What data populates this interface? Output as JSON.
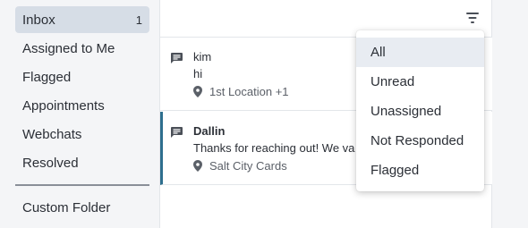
{
  "sidebar": {
    "items": [
      {
        "label": "Inbox",
        "count": "1",
        "active": true
      },
      {
        "label": "Assigned to Me"
      },
      {
        "label": "Flagged"
      },
      {
        "label": "Appointments"
      },
      {
        "label": "Webchats"
      },
      {
        "label": "Resolved"
      }
    ],
    "custom_folder": "Custom Folder"
  },
  "conversations": [
    {
      "name": "kim",
      "message": "hi",
      "location": "1st Location +1"
    },
    {
      "name": "Dallin",
      "message": "Thanks for reaching out! We va",
      "location": "Salt City Cards"
    }
  ],
  "filter_menu": {
    "options": [
      "All",
      "Unread",
      "Unassigned",
      "Not Responded",
      "Flagged"
    ],
    "selected": "All"
  },
  "colors": {
    "accent": "#2e6f8e",
    "active_nav": "#d6dde6",
    "menu_selected": "#e8ecf2"
  },
  "icons": {
    "filter": "filter-icon",
    "message": "message-icon",
    "location": "location-pin-icon"
  }
}
